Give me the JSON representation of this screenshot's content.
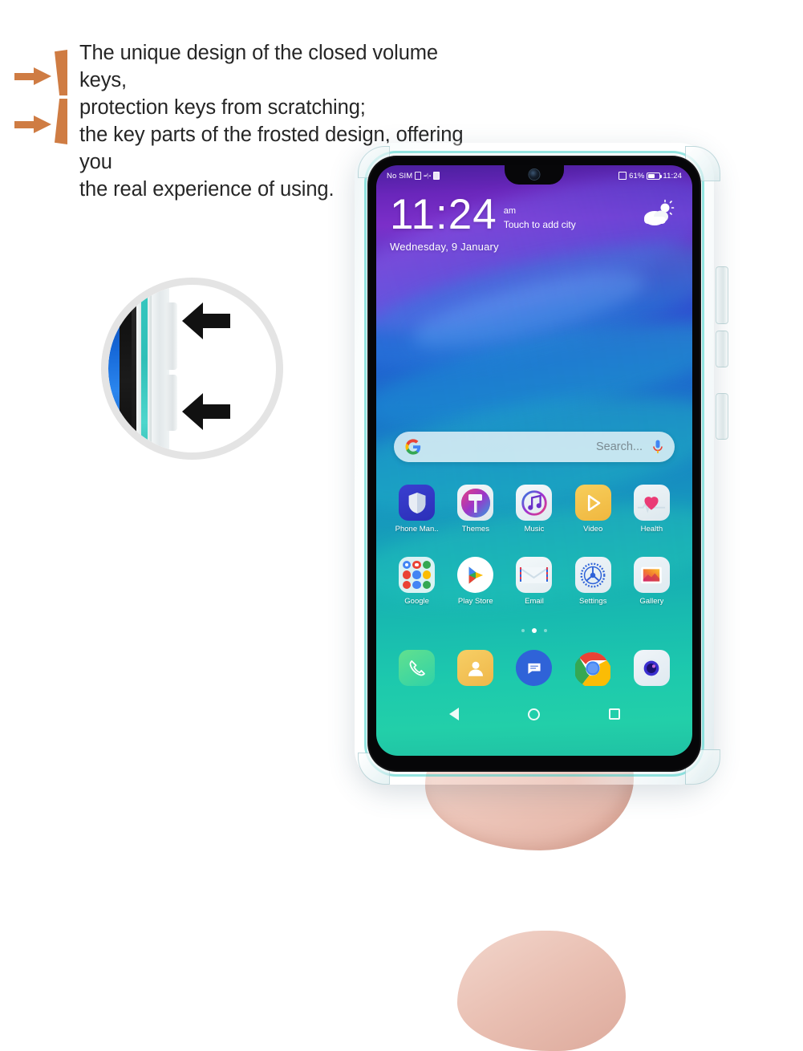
{
  "headline": {
    "text": "The unique design of the closed volume keys,\nprotection keys from scratching;\nthe key parts of the frosted design, offering you\nthe real experience of using.",
    "accent_color": "#cf7c43",
    "text_color": "#262626"
  },
  "magnifier": {
    "alt": "close-up cross-section of case covering volume keys",
    "arrow_count": 2,
    "arrow_color": "#111111",
    "ring_color": "#e4e4e4"
  },
  "phone": {
    "status_bar": {
      "carrier": "No SIM",
      "battery_percent": "61%",
      "battery_level": 61,
      "time": "11:24",
      "icons": [
        "sim-icon",
        "vibrate-icon",
        "sd-card-icon",
        "signal-icon",
        "battery-icon"
      ]
    },
    "clock_widget": {
      "time": "11:24",
      "ampm": "am",
      "city": "Touch to add city",
      "date": "Wednesday, 9 January",
      "weather_icon": "partly-cloudy-icon"
    },
    "search": {
      "placeholder": "Search...",
      "logo": "google-g-icon",
      "mic": "microphone-icon"
    },
    "apps_row_1": [
      {
        "label": "Phone Man..",
        "icon": "shield-icon"
      },
      {
        "label": "Themes",
        "icon": "paint-roller-icon"
      },
      {
        "label": "Music",
        "icon": "music-note-icon"
      },
      {
        "label": "Video",
        "icon": "play-triangle-icon"
      },
      {
        "label": "Health",
        "icon": "heart-icon"
      }
    ],
    "apps_row_2": [
      {
        "label": "Google",
        "icon": "google-folder-icon"
      },
      {
        "label": "Play Store",
        "icon": "play-store-icon"
      },
      {
        "label": "Email",
        "icon": "envelope-icon"
      },
      {
        "label": "Settings",
        "icon": "gear-dial-icon"
      },
      {
        "label": "Gallery",
        "icon": "photo-frame-icon"
      }
    ],
    "dock": [
      {
        "label": "Phone",
        "icon": "handset-icon"
      },
      {
        "label": "Contacts",
        "icon": "person-icon"
      },
      {
        "label": "Messages",
        "icon": "speech-bubble-icon"
      },
      {
        "label": "Chrome",
        "icon": "chrome-icon"
      },
      {
        "label": "Camera",
        "icon": "camera-lens-icon"
      }
    ],
    "page_dots": {
      "count": 3,
      "active_index": 1
    },
    "nav_bar": [
      "back-icon",
      "home-icon",
      "recents-icon"
    ],
    "wallpaper_colors": [
      "#6a26bb",
      "#2f4fd0",
      "#1690c0",
      "#22cfa9"
    ]
  },
  "case": {
    "accent_color": "#3ed0c8",
    "side_keys": 3
  }
}
